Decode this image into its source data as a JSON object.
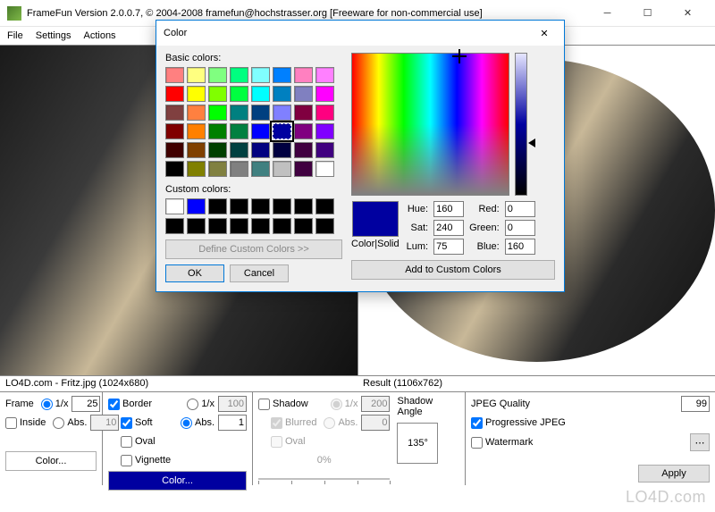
{
  "window": {
    "title": "FrameFun Version 2.0.0.7, © 2004-2008 framefun@hochstrasser.org [Freeware for non-commercial use]"
  },
  "menu": {
    "file": "File",
    "settings": "Settings",
    "actions": "Actions"
  },
  "labels": {
    "source": "LO4D.com - Fritz.jpg (1024x680)",
    "result": "Result (1106x762)"
  },
  "frame": {
    "title": "Frame",
    "oneOverX": "1/x",
    "oneOverXVal": "25",
    "abs": "Abs.",
    "absVal": "10",
    "inside": "Inside",
    "colorBtn": "Color..."
  },
  "border": {
    "border": "Border",
    "soft": "Soft",
    "oval": "Oval",
    "vignette": "Vignette",
    "oneOverX": "1/x",
    "oneOverXVal": "100",
    "abs": "Abs.",
    "absVal": "1",
    "colorBtn": "Color..."
  },
  "shadow": {
    "shadow": "Shadow",
    "blurred": "Blurred",
    "oval": "Oval",
    "oneOverX": "1/x",
    "oneOverXVal": "200",
    "abs": "Abs.",
    "absVal": "0",
    "pct": "0%",
    "angleLabel": "Shadow Angle",
    "angleVal": "135°"
  },
  "jpeg": {
    "quality": "JPEG Quality",
    "qualityVal": "99",
    "progressive": "Progressive JPEG",
    "watermark": "Watermark",
    "apply": "Apply"
  },
  "colorDialog": {
    "title": "Color",
    "basic": "Basic colors:",
    "custom": "Custom colors:",
    "define": "Define Custom Colors >>",
    "ok": "OK",
    "cancel": "Cancel",
    "colorSolid": "Color|Solid",
    "hue": "Hue:",
    "hueVal": "160",
    "sat": "Sat:",
    "satVal": "240",
    "lum": "Lum:",
    "lumVal": "75",
    "red": "Red:",
    "redVal": "0",
    "green": "Green:",
    "greenVal": "0",
    "blue": "Blue:",
    "blueVal": "160",
    "add": "Add to Custom Colors",
    "basicColors": [
      "#ff8080",
      "#ffff80",
      "#80ff80",
      "#00ff80",
      "#80ffff",
      "#0080ff",
      "#ff80c0",
      "#ff80ff",
      "#ff0000",
      "#ffff00",
      "#80ff00",
      "#00ff40",
      "#00ffff",
      "#0080c0",
      "#8080c0",
      "#ff00ff",
      "#804040",
      "#ff8040",
      "#00ff00",
      "#008080",
      "#004080",
      "#8080ff",
      "#800040",
      "#ff0080",
      "#800000",
      "#ff8000",
      "#008000",
      "#008040",
      "#0000ff",
      "#0000a0",
      "#800080",
      "#8000ff",
      "#400000",
      "#804000",
      "#004000",
      "#004040",
      "#000080",
      "#000040",
      "#400040",
      "#400080",
      "#000000",
      "#808000",
      "#808040",
      "#808080",
      "#408080",
      "#c0c0c0",
      "#400040",
      "#ffffff"
    ],
    "customColors": [
      "#ffffff",
      "#0000ff",
      "#000000",
      "#000000",
      "#000000",
      "#000000",
      "#000000",
      "#000000",
      "#000000",
      "#000000",
      "#000000",
      "#000000",
      "#000000",
      "#000000",
      "#000000",
      "#000000"
    ],
    "selectedIndex": 29
  },
  "watermarkText": "LO4D.com"
}
